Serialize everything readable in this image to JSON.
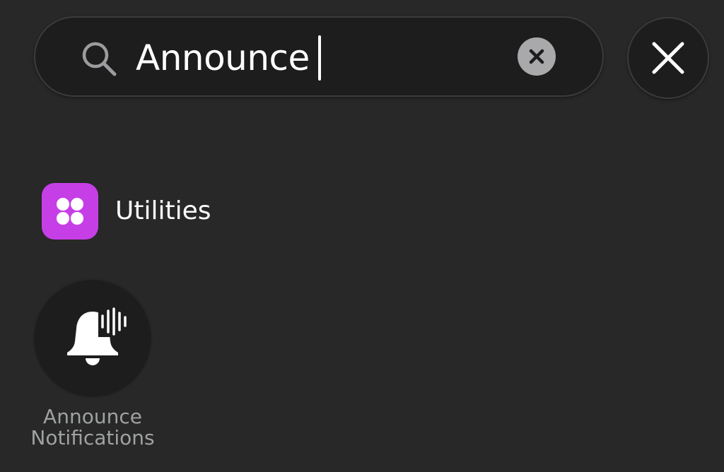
{
  "search": {
    "value": "Announce",
    "icon": "search-icon"
  },
  "search_bar": {
    "clear_icon": "clear-circle-icon",
    "close_icon": "close-icon"
  },
  "categories": [
    {
      "label": "Utilities",
      "icon": "utilities-icon",
      "color": "#c63fe6"
    }
  ],
  "actions": [
    {
      "label_line1": "Announce",
      "label_line2": "Notifications",
      "icon": "announce-bell-icon"
    }
  ],
  "colors": {
    "background": "#272827",
    "field": "#1c1d1c",
    "accent_purple": "#c63fe6",
    "secondary_text": "#a0a1a3"
  }
}
